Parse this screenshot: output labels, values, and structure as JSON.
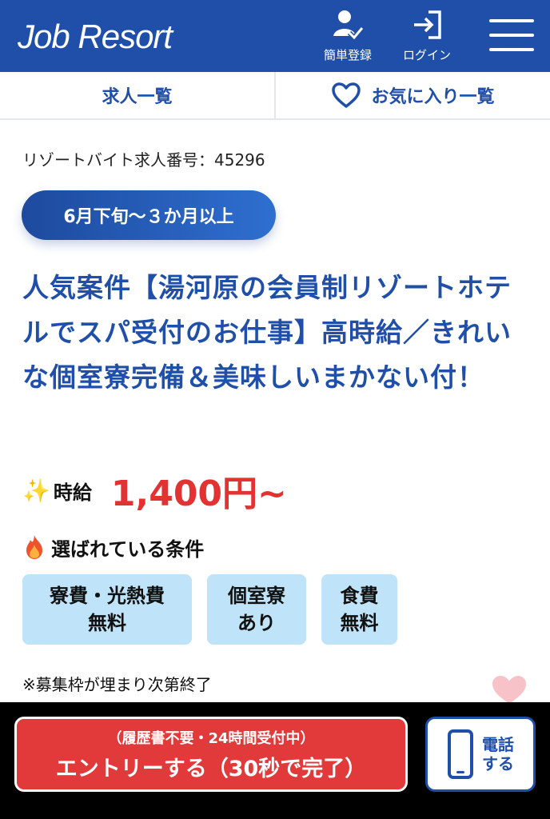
{
  "header": {
    "logo": "Job Resort",
    "register_label": "簡単登録",
    "login_label": "ログイン",
    "brand_color": "#1f4fa8"
  },
  "subnav": {
    "jobs_label": "求人一覧",
    "favorites_label": "お気に入り一覧"
  },
  "job": {
    "number_label": "リゾートバイト求人番号：45296",
    "period_badge": "6月下旬〜３か月以上",
    "title": "人気案件【湯河原の会員制リゾートホテルでスパ受付のお仕事】高時給／きれいな個室寮完備＆美味しいまかない付！",
    "wage_icon": "✨",
    "wage_label": "時給",
    "wage_amount": "1,400円~",
    "conditions_title": "選ばれている条件",
    "conditions": [
      {
        "line1": "寮費・光熱費",
        "line2": "無料"
      },
      {
        "line1": "個室寮",
        "line2": "あり"
      },
      {
        "line1": "食費",
        "line2": "無料"
      }
    ],
    "note": "※募集枠が埋まり次第終了"
  },
  "bottom": {
    "entry_sub": "（履歴書不要・24時間受付中）",
    "entry_main": "エントリーする（30秒で完了）",
    "tel_line1": "電話",
    "tel_line2": "する",
    "entry_color": "#e23a3a"
  },
  "icons": {
    "register": "user-check-icon",
    "login": "login-arrow-icon",
    "menu": "hamburger-menu-icon",
    "favorite": "heart-outline-icon",
    "sparkle": "sparkles-icon",
    "fire": "fire-icon",
    "phone": "smartphone-icon",
    "floating": "heart-icon"
  }
}
